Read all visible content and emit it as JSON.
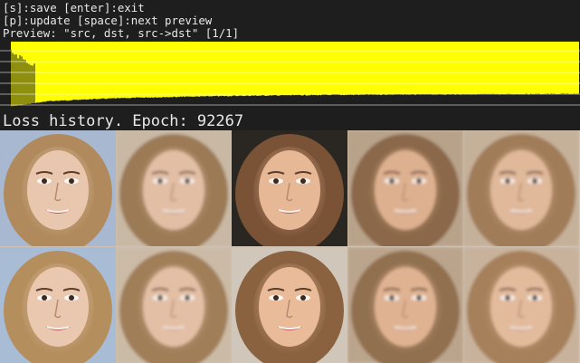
{
  "window": {
    "hotkeys": [
      "[s]:save [enter]:exit",
      "[p]:update [space]:next preview",
      "Preview: \"src, dst, src->dst\" [1/1]"
    ],
    "epoch_label": "Loss history. Epoch: 92267"
  },
  "loss_history": {
    "type": "area",
    "series": [
      {
        "values": [
          1.0,
          0.62,
          0.5,
          0.42,
          0.37,
          0.33,
          0.3,
          0.28,
          0.26,
          0.25,
          0.24,
          0.23,
          0.22
        ]
      },
      {
        "values": [
          0.9,
          0.55,
          0.44,
          0.37,
          0.32,
          0.29,
          0.27,
          0.25,
          0.23,
          0.22,
          0.21,
          0.2,
          0.19
        ]
      }
    ],
    "colors": {
      "src_loss": "#ffff00",
      "dst_loss": "#ffff00",
      "background": "#1e1e1e",
      "gridlines": "#ffffff"
    },
    "grid": true
  },
  "preview": {
    "columns": [
      "src",
      "src-reconstructed",
      "dst",
      "dst-reconstructed",
      "src->dst"
    ],
    "rows": 2,
    "faces": [
      {
        "name": "src-face-row1-col1",
        "skin": "#e9c7ae",
        "hair": "#b08a5c",
        "bg": "#a7b8d0",
        "sharp": true
      },
      {
        "name": "src-face-row1-col2",
        "skin": "#e2bea4",
        "hair": "#9b7a55",
        "bg": "#c8b8a4",
        "sharp": false
      },
      {
        "name": "dst-face-row1-col3",
        "skin": "#e7b895",
        "hair": "#7a5236",
        "bg": "#2a2622",
        "sharp": true
      },
      {
        "name": "dst-face-row1-col4",
        "skin": "#ddb090",
        "hair": "#8a6848",
        "bg": "#b8a28a",
        "sharp": false
      },
      {
        "name": "src2dst-face-row1-col5",
        "skin": "#e0b89a",
        "hair": "#a07c58",
        "bg": "#c5b09a",
        "sharp": false
      },
      {
        "name": "src-face-row2-col1",
        "skin": "#eac8b0",
        "hair": "#b58e5e",
        "bg": "#a9bcd6",
        "sharp": true
      },
      {
        "name": "src-face-row2-col2",
        "skin": "#e3bfa5",
        "hair": "#a07e58",
        "bg": "#cbbba6",
        "sharp": false
      },
      {
        "name": "dst-face-row2-col3",
        "skin": "#e9bb98",
        "hair": "#8a6240",
        "bg": "#d0c6ba",
        "sharp": true
      },
      {
        "name": "dst-face-row2-col4",
        "skin": "#dfb292",
        "hair": "#917050",
        "bg": "#bba48c",
        "sharp": false
      },
      {
        "name": "src2dst-face-row2-col5",
        "skin": "#e2ba9c",
        "hair": "#a5805a",
        "bg": "#c8b29c",
        "sharp": false
      }
    ]
  }
}
